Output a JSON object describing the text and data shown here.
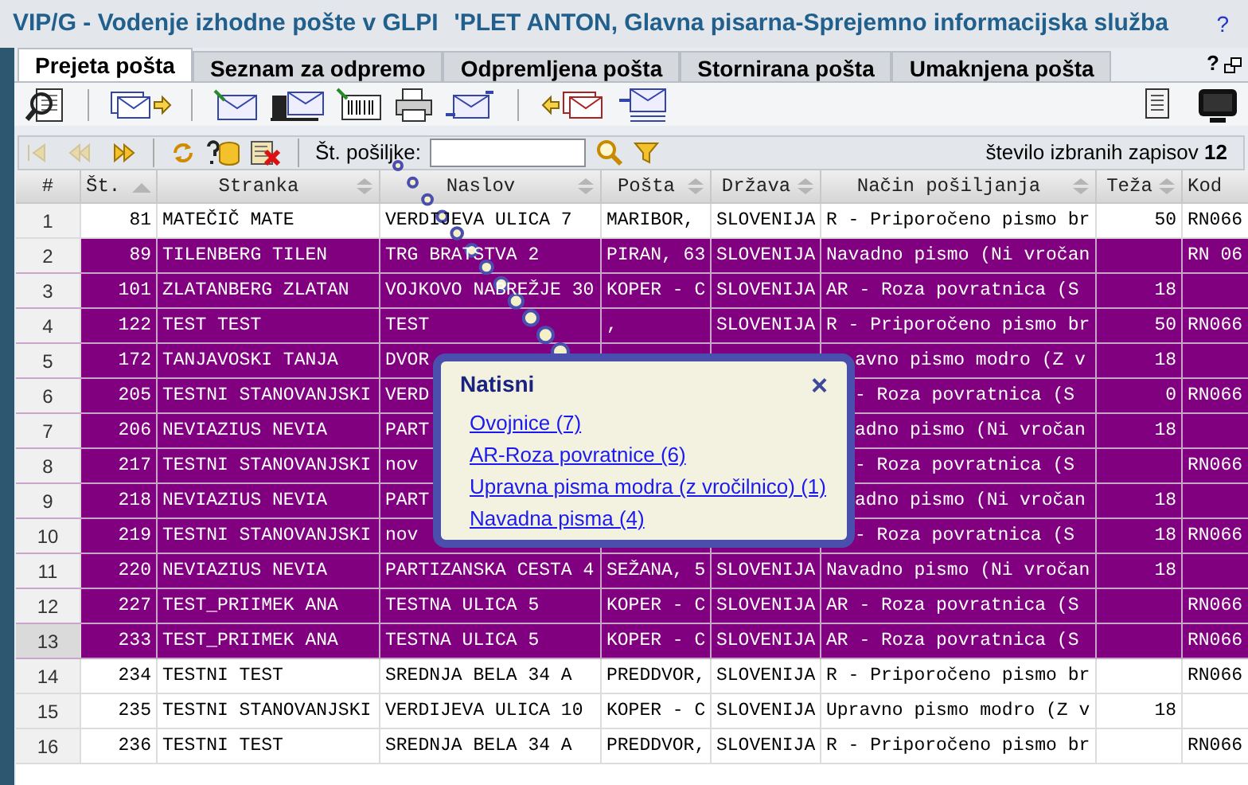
{
  "window": {
    "title": "VIP/G - Vodenje izhodne pošte v GLPI",
    "user": "'PLET ANTON, Glavna pisarna-Sprejemno informacijska služba",
    "help": "?"
  },
  "tabs": [
    {
      "label": "Prejeta pošta",
      "selected": true
    },
    {
      "label": "Seznam za odpremo",
      "selected": false
    },
    {
      "label": "Odpremljena pošta",
      "selected": false
    },
    {
      "label": "Stornirana pošta",
      "selected": false
    },
    {
      "label": "Umaknjena pošta",
      "selected": false
    }
  ],
  "tab_help": "?",
  "search": {
    "label": "Št. pošiljke:"
  },
  "record_count": "število izbranih zapisov **12**",
  "table": {
    "columns": [
      {
        "label": "#",
        "kind": "plain"
      },
      {
        "label": "Št.",
        "kind": "sorted"
      },
      {
        "label": "Stranka",
        "kind": "sortable"
      },
      {
        "label": "Naslov",
        "kind": "sortable"
      },
      {
        "label": "Pošta",
        "kind": "sortable"
      },
      {
        "label": "Država",
        "kind": "sortable"
      },
      {
        "label": "Način pošiljanja",
        "kind": "sortable"
      },
      {
        "label": "Teža",
        "kind": "sortable"
      },
      {
        "label": "Kod",
        "kind": "plain"
      }
    ],
    "rows": [
      {
        "selected": false,
        "hovered": false,
        "cells": [
          "1",
          "81",
          "MATEČIČ MATE",
          "VERDIJEVA ULICA 7",
          "MARIBOR,",
          "SLOVENIJA",
          "R - Priporočeno pismo br",
          "50",
          "RN066"
        ]
      },
      {
        "selected": true,
        "hovered": false,
        "cells": [
          "2",
          "89",
          "TILENBERG TILEN",
          "TRG BRATSTVA 2",
          "PIRAN, 63",
          "SLOVENIJA",
          "Navadno pismo (Ni vročan",
          "",
          "RN 06"
        ]
      },
      {
        "selected": true,
        "hovered": false,
        "cells": [
          "3",
          "101",
          "ZLATANBERG ZLATAN",
          "VOJKOVO NABREŽJE 30",
          "KOPER - C",
          "SLOVENIJA",
          "AR - Roza povratnica (S",
          "18",
          ""
        ]
      },
      {
        "selected": true,
        "hovered": false,
        "cells": [
          "4",
          "122",
          "TEST TEST",
          "TEST",
          ",",
          "SLOVENIJA",
          "R - Priporočeno pismo br",
          "50",
          "RN066"
        ]
      },
      {
        "selected": true,
        "hovered": false,
        "cells": [
          "5",
          "172",
          "TANJAVOSKI TANJA",
          "DVOR",
          "",
          "",
          "avno pismo modro (Z v",
          "18",
          ""
        ]
      },
      {
        "selected": true,
        "hovered": false,
        "cells": [
          "6",
          "205",
          "TESTNI STANOVANJSKI",
          "VERD",
          "",
          "",
          "- Roza povratnica (S",
          "0",
          "RN066"
        ]
      },
      {
        "selected": true,
        "hovered": false,
        "cells": [
          "7",
          "206",
          "NEVIAZIUS NEVIA",
          "PART",
          "",
          "",
          "adno pismo (Ni vročan",
          "18",
          ""
        ]
      },
      {
        "selected": true,
        "hovered": false,
        "cells": [
          "8",
          "217",
          "TESTNI STANOVANJSKI",
          "nov",
          "",
          "",
          "- Roza povratnica (S",
          "",
          "RN066"
        ]
      },
      {
        "selected": true,
        "hovered": false,
        "cells": [
          "9",
          "218",
          "NEVIAZIUS NEVIA",
          "PART",
          "",
          "",
          "adno pismo (Ni vročan",
          "18",
          ""
        ]
      },
      {
        "selected": true,
        "hovered": false,
        "cells": [
          "10",
          "219",
          "TESTNI STANOVANJSKI",
          "nov",
          "",
          "",
          "- Roza povratnica (S",
          "18",
          "RN066"
        ]
      },
      {
        "selected": true,
        "hovered": false,
        "cells": [
          "11",
          "220",
          "NEVIAZIUS NEVIA",
          "PARTIZANSKA CESTA 4",
          "SEŽANA, 5",
          "SLOVENIJA",
          "Navadno pismo (Ni vročan",
          "18",
          ""
        ]
      },
      {
        "selected": true,
        "hovered": false,
        "cells": [
          "12",
          "227",
          "TEST_PRIIMEK ANA",
          "TESTNA ULICA 5",
          "KOPER - C",
          "SLOVENIJA",
          "AR - Roza povratnica (S",
          "",
          "RN066"
        ]
      },
      {
        "selected": true,
        "hovered": true,
        "cells": [
          "13",
          "233",
          "TEST_PRIIMEK ANA",
          "TESTNA ULICA 5",
          "KOPER - C",
          "SLOVENIJA",
          "AR - Roza povratnica (S",
          "",
          "RN066"
        ]
      },
      {
        "selected": false,
        "hovered": false,
        "cells": [
          "14",
          "234",
          "TESTNI TEST",
          "SREDNJA BELA 34 A",
          "PREDDVOR,",
          "SLOVENIJA",
          "R - Priporočeno pismo br",
          "",
          "RN066"
        ]
      },
      {
        "selected": false,
        "hovered": false,
        "cells": [
          "15",
          "235",
          "TESTNI STANOVANJSKI",
          "VERDIJEVA ULICA 10",
          "KOPER - C",
          "SLOVENIJA",
          "Upravno pismo modro (Z v",
          "18",
          ""
        ]
      },
      {
        "selected": false,
        "hovered": false,
        "cells": [
          "16",
          "236",
          "TESTNI TEST",
          "SREDNJA BELA 34 A",
          "PREDDVOR,",
          "SLOVENIJA",
          "R - Priporočeno pismo br",
          "",
          "RN066"
        ]
      }
    ]
  },
  "popup": {
    "title": "Natisni",
    "close": "×",
    "links": [
      "Ovojnice (7)",
      "AR-Roza povratnice (6)",
      "Upravna pisma modra (z vročilnico) (1)",
      "Navadna pisma (4)"
    ]
  }
}
